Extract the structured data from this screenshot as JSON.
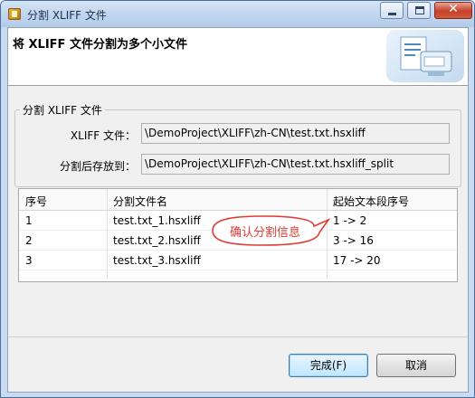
{
  "window": {
    "title": "分割 XLIFF 文件"
  },
  "header": {
    "title": "将 XLIFF 文件分割为多个小文件"
  },
  "group": {
    "legend": "分割 XLIFF 文件",
    "xliff_label": "XLIFF 文件：",
    "xliff_value": "\\DemoProject\\XLIFF\\zh-CN\\test.txt.hsxliff",
    "split_label": "分割后存放到：",
    "split_value": "\\DemoProject\\XLIFF\\zh-CN\\test.txt.hsxliff_split"
  },
  "table": {
    "columns": [
      "序号",
      "分割文件名",
      "起始文本段序号"
    ],
    "rows": [
      [
        "1",
        "test.txt_1.hsxliff",
        "1 -> 2"
      ],
      [
        "2",
        "test.txt_2.hsxliff",
        "3 -> 16"
      ],
      [
        "3",
        "test.txt_3.hsxliff",
        "17 -> 20"
      ]
    ]
  },
  "callout": {
    "text": "确认分割信息",
    "color": "#e23a32"
  },
  "buttons": {
    "finish": "完成(F)",
    "cancel": "取消"
  }
}
